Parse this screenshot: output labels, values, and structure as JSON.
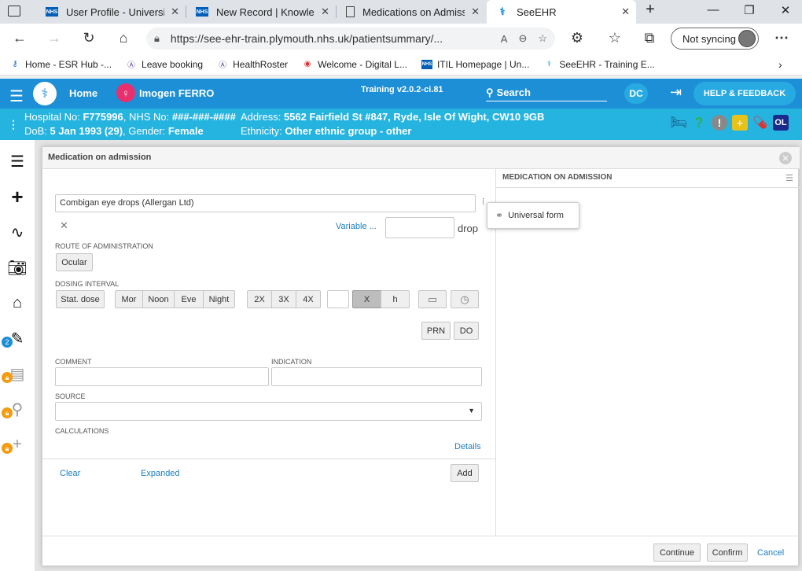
{
  "browser": {
    "tabs": [
      {
        "title": "User Profile - University",
        "icon": "nhs-favicon"
      },
      {
        "title": "New Record | Knowledg",
        "icon": "nhs-favicon"
      },
      {
        "title": "Medications on Admiss",
        "icon": "document-icon"
      },
      {
        "title": "SeeEHR",
        "icon": "seeehr-favicon"
      }
    ],
    "url": "https://see-ehr-train.plymouth.nhs.uk/patientsummary/...",
    "sync_label": "Not syncing",
    "bookmarks": [
      {
        "label": "Home - ESR Hub -...",
        "icon": "key-icon"
      },
      {
        "label": "Leave booking",
        "icon": "circle-a-icon"
      },
      {
        "label": "HealthRoster",
        "icon": "circle-a-icon"
      },
      {
        "label": "Welcome - Digital L...",
        "icon": "globe-icon"
      },
      {
        "label": "ITIL Homepage | Un...",
        "icon": "nhs-favicon"
      },
      {
        "label": "SeeEHR - Training E...",
        "icon": "seeehr-favicon"
      }
    ]
  },
  "app": {
    "home_label": "Home",
    "patient_name": "Imogen FERRO",
    "training_label": "Training v2.0.2-ci.81",
    "search_label": "Search",
    "user_initials": "DC",
    "help_label": "HELP & FEEDBACK",
    "banner": {
      "hospital_prefix": "Hospital No:",
      "hospital_no": "F775996",
      "nhs_prefix": ", NHS No:",
      "nhs_no": "###-###-####",
      "address_prefix": "Address:",
      "address": "5562 Fairfield St #847, Ryde, Isle Of Wight, CW10 9GB",
      "dob_prefix": "DoB:",
      "dob": "5 Jan 1993 (29)",
      "gender_prefix": ", Gender:",
      "gender": "Female",
      "ethnicity_prefix": "Ethnicity:",
      "ethnicity": "Other ethnic group - other",
      "ol_badge": "OL"
    },
    "sidebar_badge": "2"
  },
  "modal": {
    "title": "Medication on admission",
    "drug": "Combigan eye drops (Allergan Ltd)",
    "variable_label": "Variable ...",
    "dose_value": "",
    "dose_unit": "drop",
    "route_label": "ROUTE OF ADMINISTRATION",
    "route_value": "Ocular",
    "dosing_label": "DOSING INTERVAL",
    "stat_label": "Stat. dose",
    "times": [
      "Mor",
      "Noon",
      "Eve",
      "Night"
    ],
    "freqs": [
      "2X",
      "3X",
      "4X"
    ],
    "interval_value": "",
    "x_label": "X",
    "h_label": "h",
    "prn_label": "PRN",
    "do_label": "DO",
    "comment_label": "COMMENT",
    "indication_label": "INDICATION",
    "source_label": "SOURCE",
    "calculations_label": "CALCULATIONS",
    "details_label": "Details",
    "clear_label": "Clear",
    "expanded_label": "Expanded",
    "add_label": "Add",
    "right_header": "MEDICATION ON ADMISSION",
    "tooltip": "Universal form",
    "continue_label": "Continue",
    "confirm_label": "Confirm",
    "cancel_label": "Cancel"
  }
}
